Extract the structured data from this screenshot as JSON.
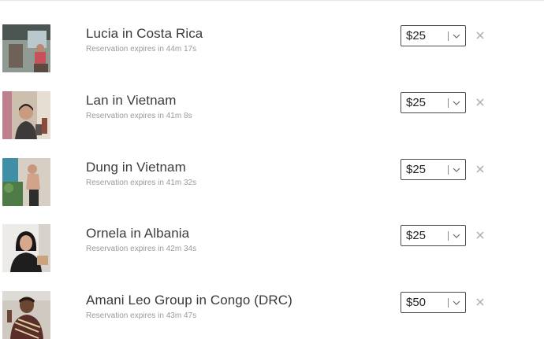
{
  "reservations": [
    {
      "name": "Lucia in Costa Rica",
      "expires": "Reservation expires in 44m 17s",
      "amount": "$25",
      "photo_colors": {
        "bg": "#5b6a63",
        "accent": "#c8505a",
        "skin": "#b9876d"
      }
    },
    {
      "name": "Lan in Vietnam",
      "expires": "Reservation expires in 41m 8s",
      "amount": "$25",
      "photo_colors": {
        "bg": "#c9b9a7",
        "accent": "#3f3a3a",
        "skin": "#c99b80"
      }
    },
    {
      "name": "Dung in Vietnam",
      "expires": "Reservation expires in 41m 32s",
      "amount": "$25",
      "photo_colors": {
        "bg": "#4a9bb0",
        "accent": "#2d2d2d",
        "skin": "#c8977e"
      }
    },
    {
      "name": "Ornela in Albania",
      "expires": "Reservation expires in 42m 34s",
      "amount": "$25",
      "photo_colors": {
        "bg": "#e8e6e2",
        "accent": "#1e1e1e",
        "skin": "#d6a98f"
      }
    },
    {
      "name": "Amani Leo Group in Congo (DRC)",
      "expires": "Reservation expires in 43m 47s",
      "amount": "$50",
      "photo_colors": {
        "bg": "#c9c4be",
        "accent": "#5a2d2a",
        "skin": "#6b4633"
      }
    }
  ],
  "icons": {
    "dropdown": "chevron-down-icon",
    "remove": "close-icon"
  },
  "colors": {
    "text_primary": "#3b3b3b",
    "text_secondary": "#9a9a9a",
    "select_border": "#4a4a4a",
    "remove_icon": "#b5b5b5"
  }
}
